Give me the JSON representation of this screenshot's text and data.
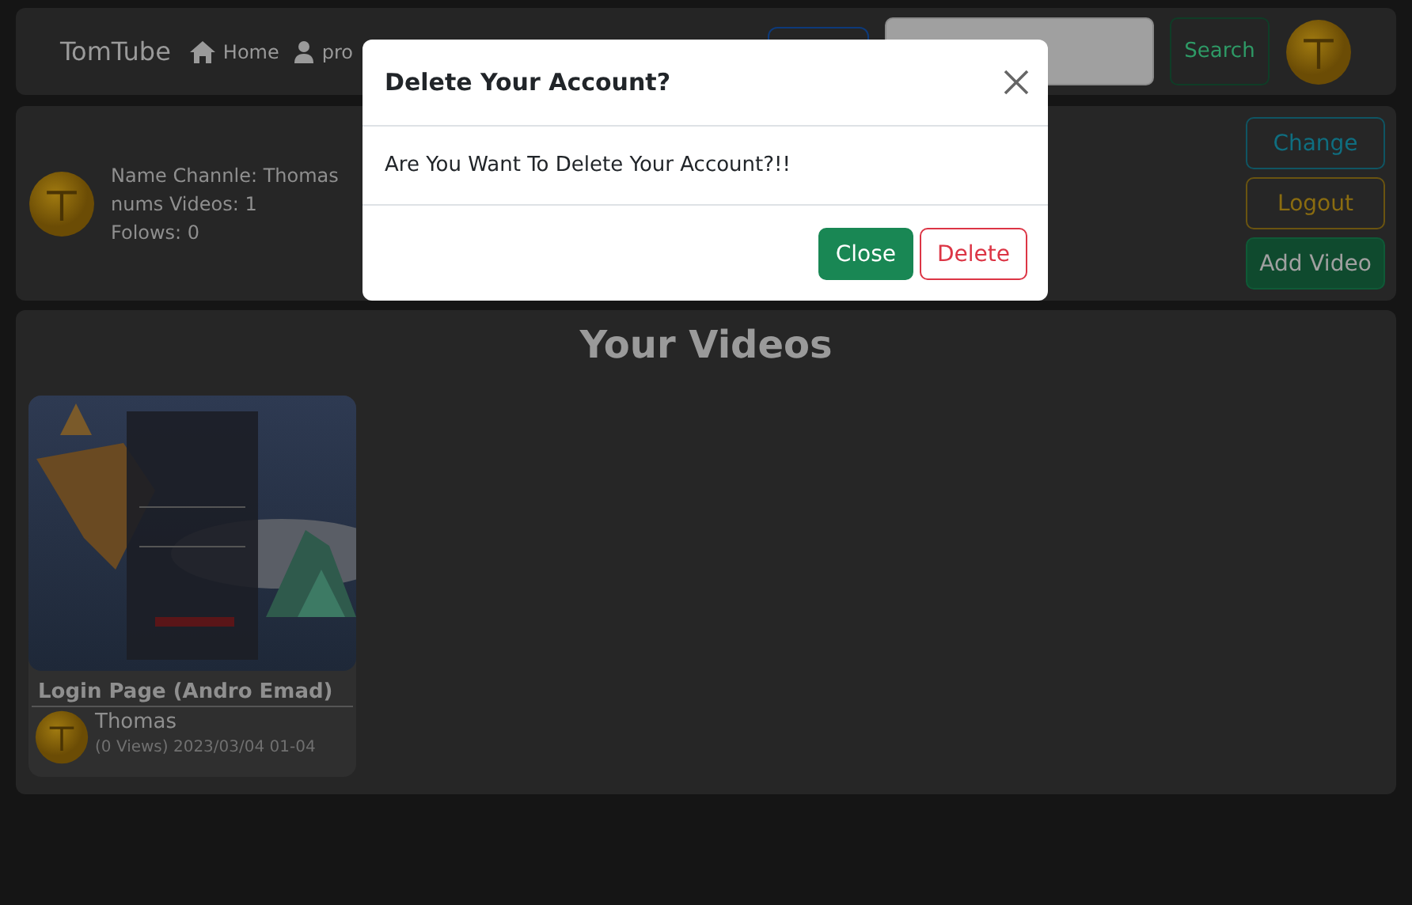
{
  "navbar": {
    "brand": "TomTube",
    "links": [
      {
        "label": "Home"
      },
      {
        "label": "pro"
      }
    ],
    "search": {
      "button": "Search"
    }
  },
  "profile": {
    "lines": [
      "Name Channle: Thomas",
      "nums Videos: 1",
      "Folows: 0"
    ],
    "buttons": [
      {
        "label": "Change",
        "kind": "info"
      },
      {
        "label": "Logout",
        "kind": "warning"
      },
      {
        "label": "Add Video",
        "kind": "success"
      }
    ]
  },
  "videos": {
    "title": "Your Videos",
    "items": [
      {
        "kind": "picture",
        "title": "Login Page (Andro Emad)",
        "author": "Thomas",
        "meta": "(0 Views) 2023/03/04 01-04"
      }
    ]
  },
  "modal": {
    "title": "Delete Your Account?",
    "body": "Are You Want To Delete Your Account?!!",
    "buttons": [
      {
        "label": "Close",
        "kind": "success"
      },
      {
        "label": "Delete",
        "kind": "danger"
      }
    ]
  }
}
